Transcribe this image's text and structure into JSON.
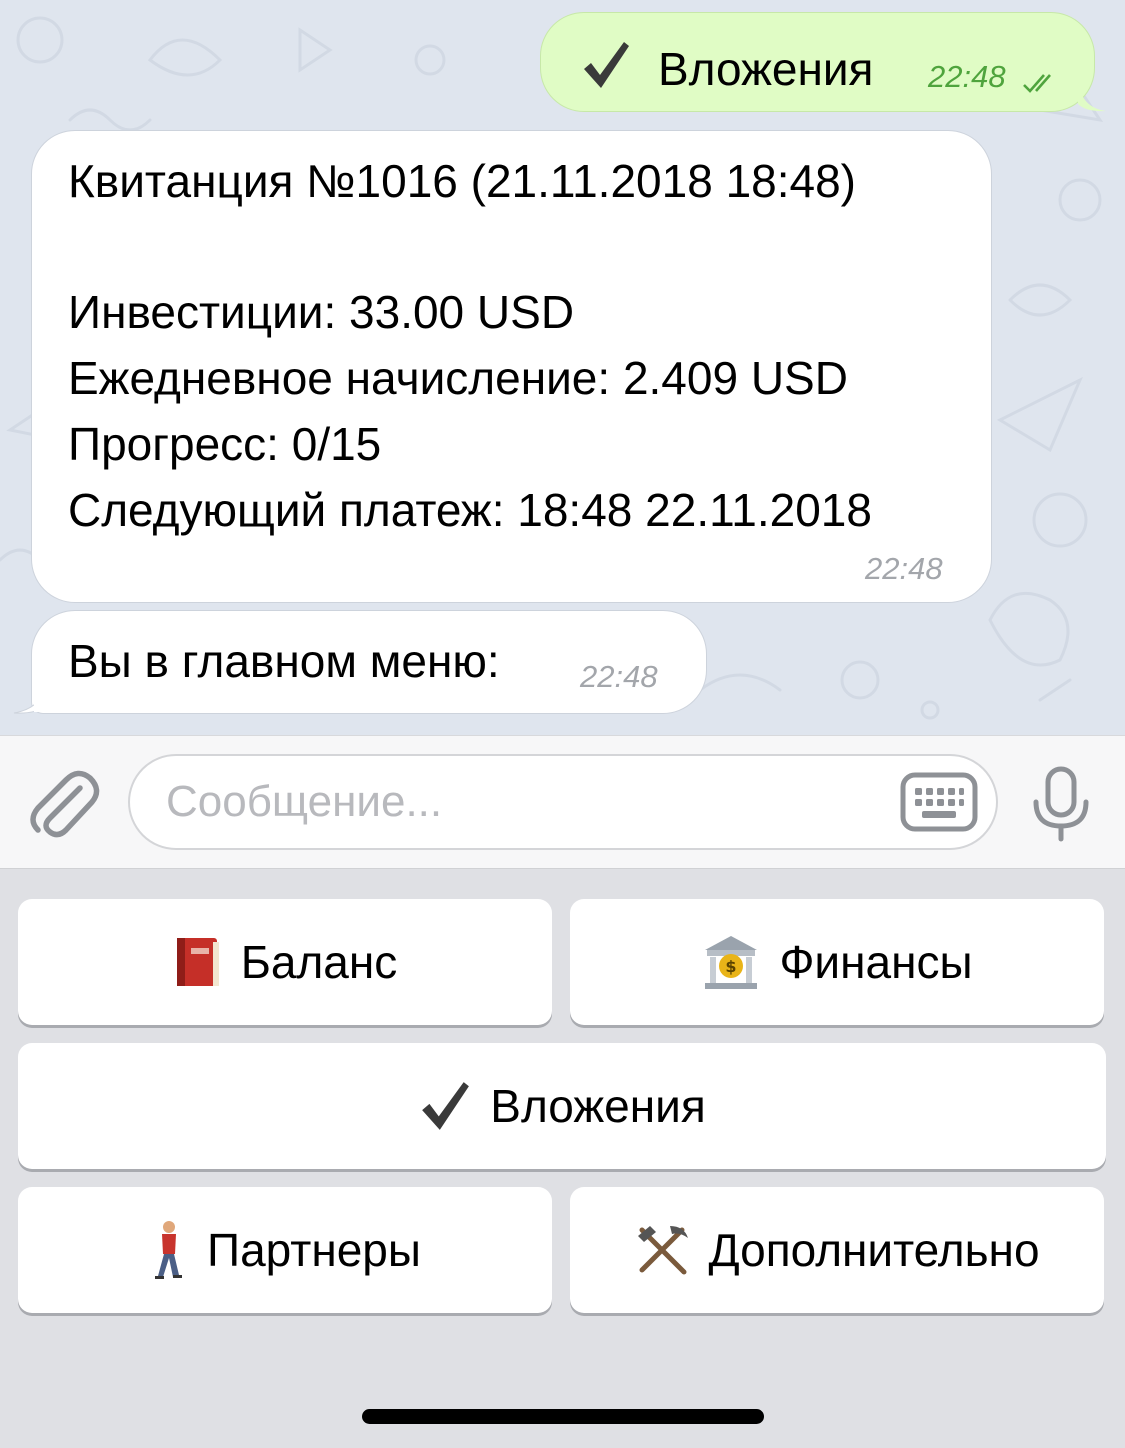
{
  "chat": {
    "outgoing": {
      "text": "Вложения",
      "time": "22:48",
      "status_icon": "double-check-icon",
      "icon": "heavy-check-mark-icon"
    },
    "receipt": {
      "lines": [
        "Квитанция №1016 (21.11.2018 18:48)",
        "",
        "Инвестиции: 33.00 USD",
        "Ежедневное начисление: 2.409 USD",
        "Прогресс: 0/15",
        "Следующий платеж: 18:48 22.11.2018"
      ],
      "time": "22:48"
    },
    "menu_message": {
      "text": "Вы в главном меню:",
      "time": "22:48"
    }
  },
  "input_panel": {
    "placeholder": "Сообщение...",
    "attach_icon": "paperclip-icon",
    "keyboard_icon": "keyboard-icon",
    "mic_icon": "microphone-icon"
  },
  "keyboard": {
    "buttons": [
      {
        "label": "Баланс",
        "icon": "red-book-icon"
      },
      {
        "label": "Финансы",
        "icon": "bank-icon"
      },
      {
        "label": "Вложения",
        "icon": "heavy-check-mark-icon"
      },
      {
        "label": "Партнеры",
        "icon": "walking-person-icon"
      },
      {
        "label": "Дополнительно",
        "icon": "hammer-and-pick-icon"
      }
    ]
  },
  "colors": {
    "chat_background": "#dfe5ee",
    "outgoing_bubble": "#e0fcc5",
    "outgoing_time": "#4fa43d",
    "incoming_bubble": "#ffffff",
    "incoming_time": "#a3a6ab",
    "keyboard_background": "#dfe0e4",
    "icon_gray": "#8e9196"
  }
}
